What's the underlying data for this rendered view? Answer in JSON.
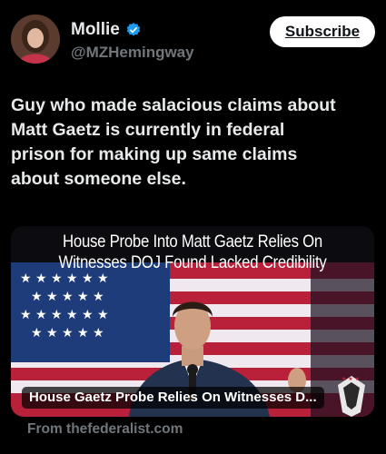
{
  "author": {
    "name": "Mollie",
    "handle": "@MZHemingway",
    "verified": true
  },
  "subscribe_label": "Subscribe",
  "tweet": {
    "text_lines": [
      "Guy who made salacious claims about",
      "Matt Gaetz is currently in federal",
      "prison for making up same claims",
      "about someone else."
    ]
  },
  "card": {
    "headline_lines": [
      "House Probe Into Matt Gaetz Relies On",
      "Witnesses DOJ Found Lacked Credibility"
    ],
    "title": "House Gaetz Probe Relies On Witnesses D...",
    "source": "From thefederalist.com"
  },
  "colors": {
    "background": "#000000",
    "text": "#e7e9ea",
    "muted": "#71767b",
    "verified_blue": "#1d9bf0",
    "flag_red": "#c8283a",
    "flag_blue": "#1f3c7a"
  }
}
